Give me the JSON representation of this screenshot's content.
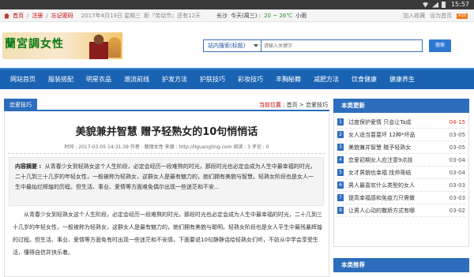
{
  "status_bar": {
    "time": "15:57"
  },
  "topbar": {
    "home": "首页",
    "register": "注册",
    "forgot": "忘记密码",
    "date": "2017年4月19日 星期三",
    "holiday": "距『劳动节』还有12天",
    "city": "长沙",
    "weather_label": "今天(周三) :",
    "temp": "20 ~ 26℃",
    "weather": "小雨",
    "add_fav": "加入收藏",
    "set_home": "设为首页",
    "rss": "RSS"
  },
  "header": {
    "logo_text": "蘭宮調女性"
  },
  "search": {
    "scope": "站内搜索(标题)",
    "placeholder": "请输入关键字",
    "button": "搜索"
  },
  "nav": {
    "items": [
      "网站首页",
      "服装搭配",
      "明星衣品",
      "潮流前线",
      "护发方法",
      "护肤技巧",
      "彩妆技巧",
      "丰胸秘籍",
      "减肥方法",
      "饮食健康",
      "健康养生"
    ]
  },
  "breadcrumb": {
    "section": "恋爱技巧",
    "position_label": "当前位置 :",
    "home": "首页",
    "sep": ">",
    "current": "恋爱技巧"
  },
  "article": {
    "title": "美貌兼并智慧 赠予轻熟女的10句悄悄话",
    "meta": "时间 : 2017-03-05 14:31:39   作者 : 靓丽女性   来源 : http://liguangting.com   阅读 : 3   评论 : 0",
    "summary_label": "内容摘要 :",
    "summary": "从青春少女到轻熟女这个人生阶段，必定会经历一段难熬的时光，那段时光也必定会成为人生中最幸福的时光，二十几到三十几岁的年轻女性，一般被称为轻熟女，这群女人是最有魅力的，她们拥有美貌与智慧。轻熟女阶段也是女人一生中最灿烂辉煌的历程。但生活、事业、爱情等方面难免偶尔出现一些迷茫和不安...",
    "body": "从青春少女到轻熟女这个人生阶段，必定会经历一段难熬的时光，那段时光也必定会成为人生中最幸福的时光，二十几到三十几岁的年轻女性，一般被称为轻熟女，这群女人是最有魅力的，她们拥有美貌与聪明。轻熟女阶段也是女人平生中最残暴辉煌的过程。但生活、事业、爱情等方面免有时出现一些迷茫和不安感，下面要说10句静静话给轻熟女们听，不妨从中学会享受生活，懂得自信并快乐着。"
  },
  "sidebar": {
    "recent_title": "本类更新",
    "items": [
      {
        "num": "1",
        "title": "过度保护爱情 只会让Ta成",
        "date": "04-15"
      },
      {
        "num": "2",
        "title": "女人适当耍耍坏 12种*坏品",
        "date": "03-05"
      },
      {
        "num": "3",
        "title": "美貌兼并智慧 赠予轻熟女",
        "date": "03-05"
      },
      {
        "num": "4",
        "title": "恋爱初期女人应注意9点技",
        "date": "03-04"
      },
      {
        "num": "5",
        "title": "女才男貌也幸福 找帅哥结",
        "date": "03-04"
      },
      {
        "num": "6",
        "title": "男人最喜欢什么类型的女人",
        "date": "03-03"
      },
      {
        "num": "7",
        "title": "提高幸福感和免疫力只需做",
        "date": "03-03"
      },
      {
        "num": "8",
        "title": "让男人心动的撒娇方式有哪",
        "date": "03-02"
      }
    ],
    "recommend_title": "本类推荐"
  }
}
